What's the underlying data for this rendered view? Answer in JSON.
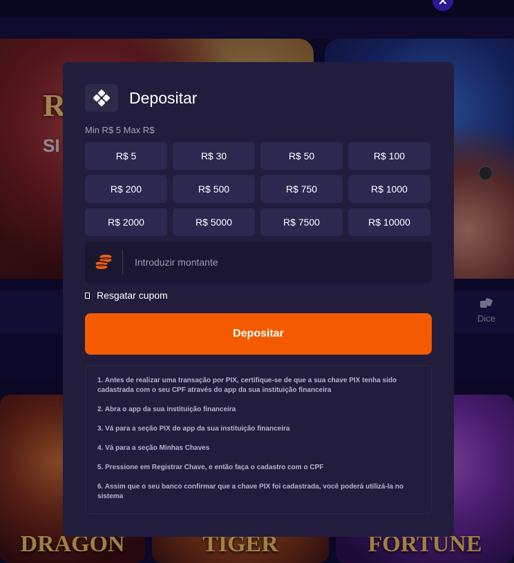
{
  "background": {
    "banner_text": "R",
    "banner_subtext": "SI",
    "category_dice_label": "Dice",
    "game_titles": [
      "DRAGON",
      "TIGER",
      "FORTUNE"
    ]
  },
  "modal": {
    "title": "Depositar",
    "limits": "Min R$ 5  Max R$",
    "amounts": [
      "R$ 5",
      "R$ 30",
      "R$ 50",
      "R$ 100",
      "R$ 200",
      "R$ 500",
      "R$ 750",
      "R$ 1000",
      "R$ 2000",
      "R$ 5000",
      "R$ 7500",
      "R$ 10000"
    ],
    "amount_input": {
      "placeholder": "Introduzir montante",
      "value": ""
    },
    "coupon_label": "Resgatar cupom",
    "deposit_button": "Depositar",
    "instructions": [
      "1. Antes de realizar uma transação por PIX, certifique-se de que a sua chave PIX tenha sido cadastrada com o seu CPF através do app da sua instituição financeira",
      "2. Abra o app da sua instituição financeira",
      "3. Vá para a seção PIX do app da sua instituição financeira",
      "4. Vá para a seção Minhas Chaves",
      "5. Pressione em Registrar Chave, e então faça o cadastro com o CPF",
      "6. Assim que o seu banco confirmar que a chave PIX foi cadastrada, você poderá utilizá-la no sistema"
    ]
  },
  "colors": {
    "modal_bg": "#221d3d",
    "amount_button_bg": "#2d2850",
    "deposit_button_bg": "#f45b00",
    "coin_icon": "#f45b00",
    "close_button_bg": "#2b1a8f"
  },
  "icons": {
    "logo": "diamond-grid-icon",
    "coin": "coins-stack-icon",
    "close": "close-icon",
    "dice": "dice-icon"
  }
}
